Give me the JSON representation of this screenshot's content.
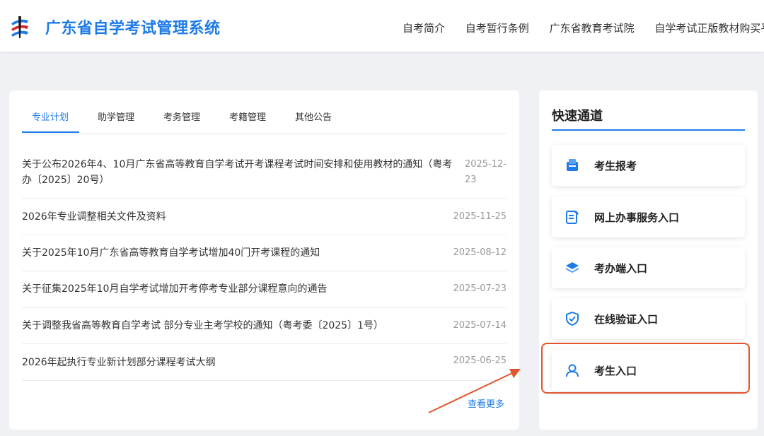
{
  "header": {
    "site_title": "广东省自学考试管理系统",
    "nav": [
      "自考简介",
      "自考暂行条例",
      "广东省教育考试院",
      "自学考试正版教材购买平台"
    ]
  },
  "news": {
    "tabs": [
      "专业计划",
      "助学管理",
      "考务管理",
      "考籍管理",
      "其他公告"
    ],
    "active_tab": "专业计划",
    "items": [
      {
        "title_line1": "关于公布2026年4、10月广东省高等教育自学考试开考课程考试时间安排和使用教材的通知（粤考",
        "title_line2": "办〔2025〕20号）",
        "date_line1": "2025-12-",
        "date_line2": "23"
      },
      {
        "title": "2026年专业调整相关文件及资料",
        "date": "2025-11-25"
      },
      {
        "title": "关于2025年10月广东省高等教育自学考试增加40门开考课程的通知",
        "date": "2025-08-12"
      },
      {
        "title": "关于征集2025年10月自学考试增加开考停考专业部分课程意向的通告",
        "date": "2025-07-23"
      },
      {
        "title": "关于调整我省高等教育自学考试 部分专业主考学校的通知（粤考委〔2025〕1号）",
        "date": "2025-07-14"
      },
      {
        "title": "2026年起执行专业新计划部分课程考试大纲",
        "date": "2025-06-25"
      }
    ],
    "more_label": "查看更多"
  },
  "quick": {
    "title": "快速通道",
    "items": [
      {
        "label": "考生报考",
        "icon": "register-icon"
      },
      {
        "label": "网上办事服务入口",
        "icon": "online-service-icon"
      },
      {
        "label": "考办端入口",
        "icon": "layers-icon"
      },
      {
        "label": "在线验证入口",
        "icon": "shield-check-icon"
      },
      {
        "label": "考生入口",
        "icon": "user-icon"
      }
    ]
  },
  "colors": {
    "accent": "#1f7be8",
    "highlight": "#e0552c"
  }
}
